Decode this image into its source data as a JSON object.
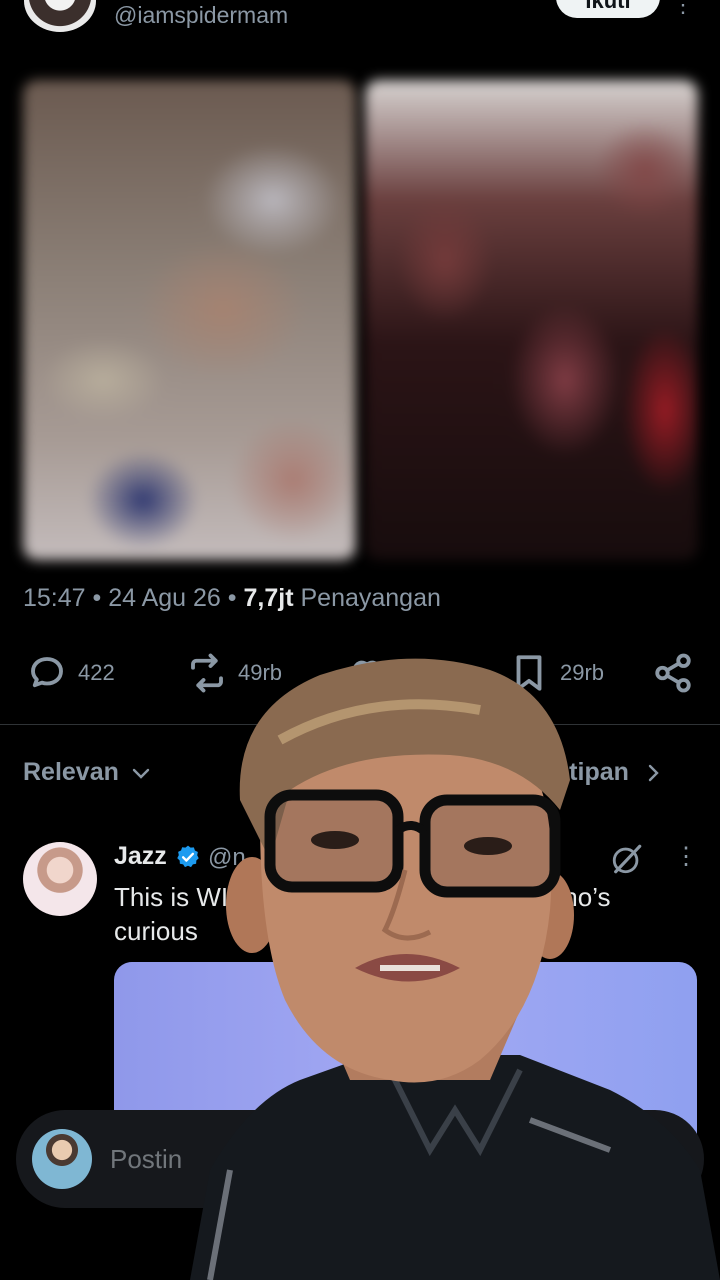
{
  "post": {
    "handle": "@iamspidermam",
    "follow_label": "Ikuti",
    "time": "15:47",
    "date": "24 Agu 26",
    "views_count": "7,7jt",
    "views_label": "Penayangan"
  },
  "actions": {
    "replies": "422",
    "reposts": "49rb",
    "bookmarks": "29rb"
  },
  "tabs": {
    "sort_label": "Relevan",
    "quotes_label": "kutipan"
  },
  "reply": {
    "name": "Jazz",
    "handle": "@n",
    "text_line1": "This is WI",
    "text_line1_end": "ple who’s",
    "text_line2": "curious"
  },
  "compose": {
    "placeholder": "Postin"
  },
  "colors": {
    "background": "#000000",
    "text_primary": "#e7e9ea",
    "text_secondary": "#8b98a5",
    "verified": "#1d9bf0",
    "divider": "#2f3336"
  }
}
